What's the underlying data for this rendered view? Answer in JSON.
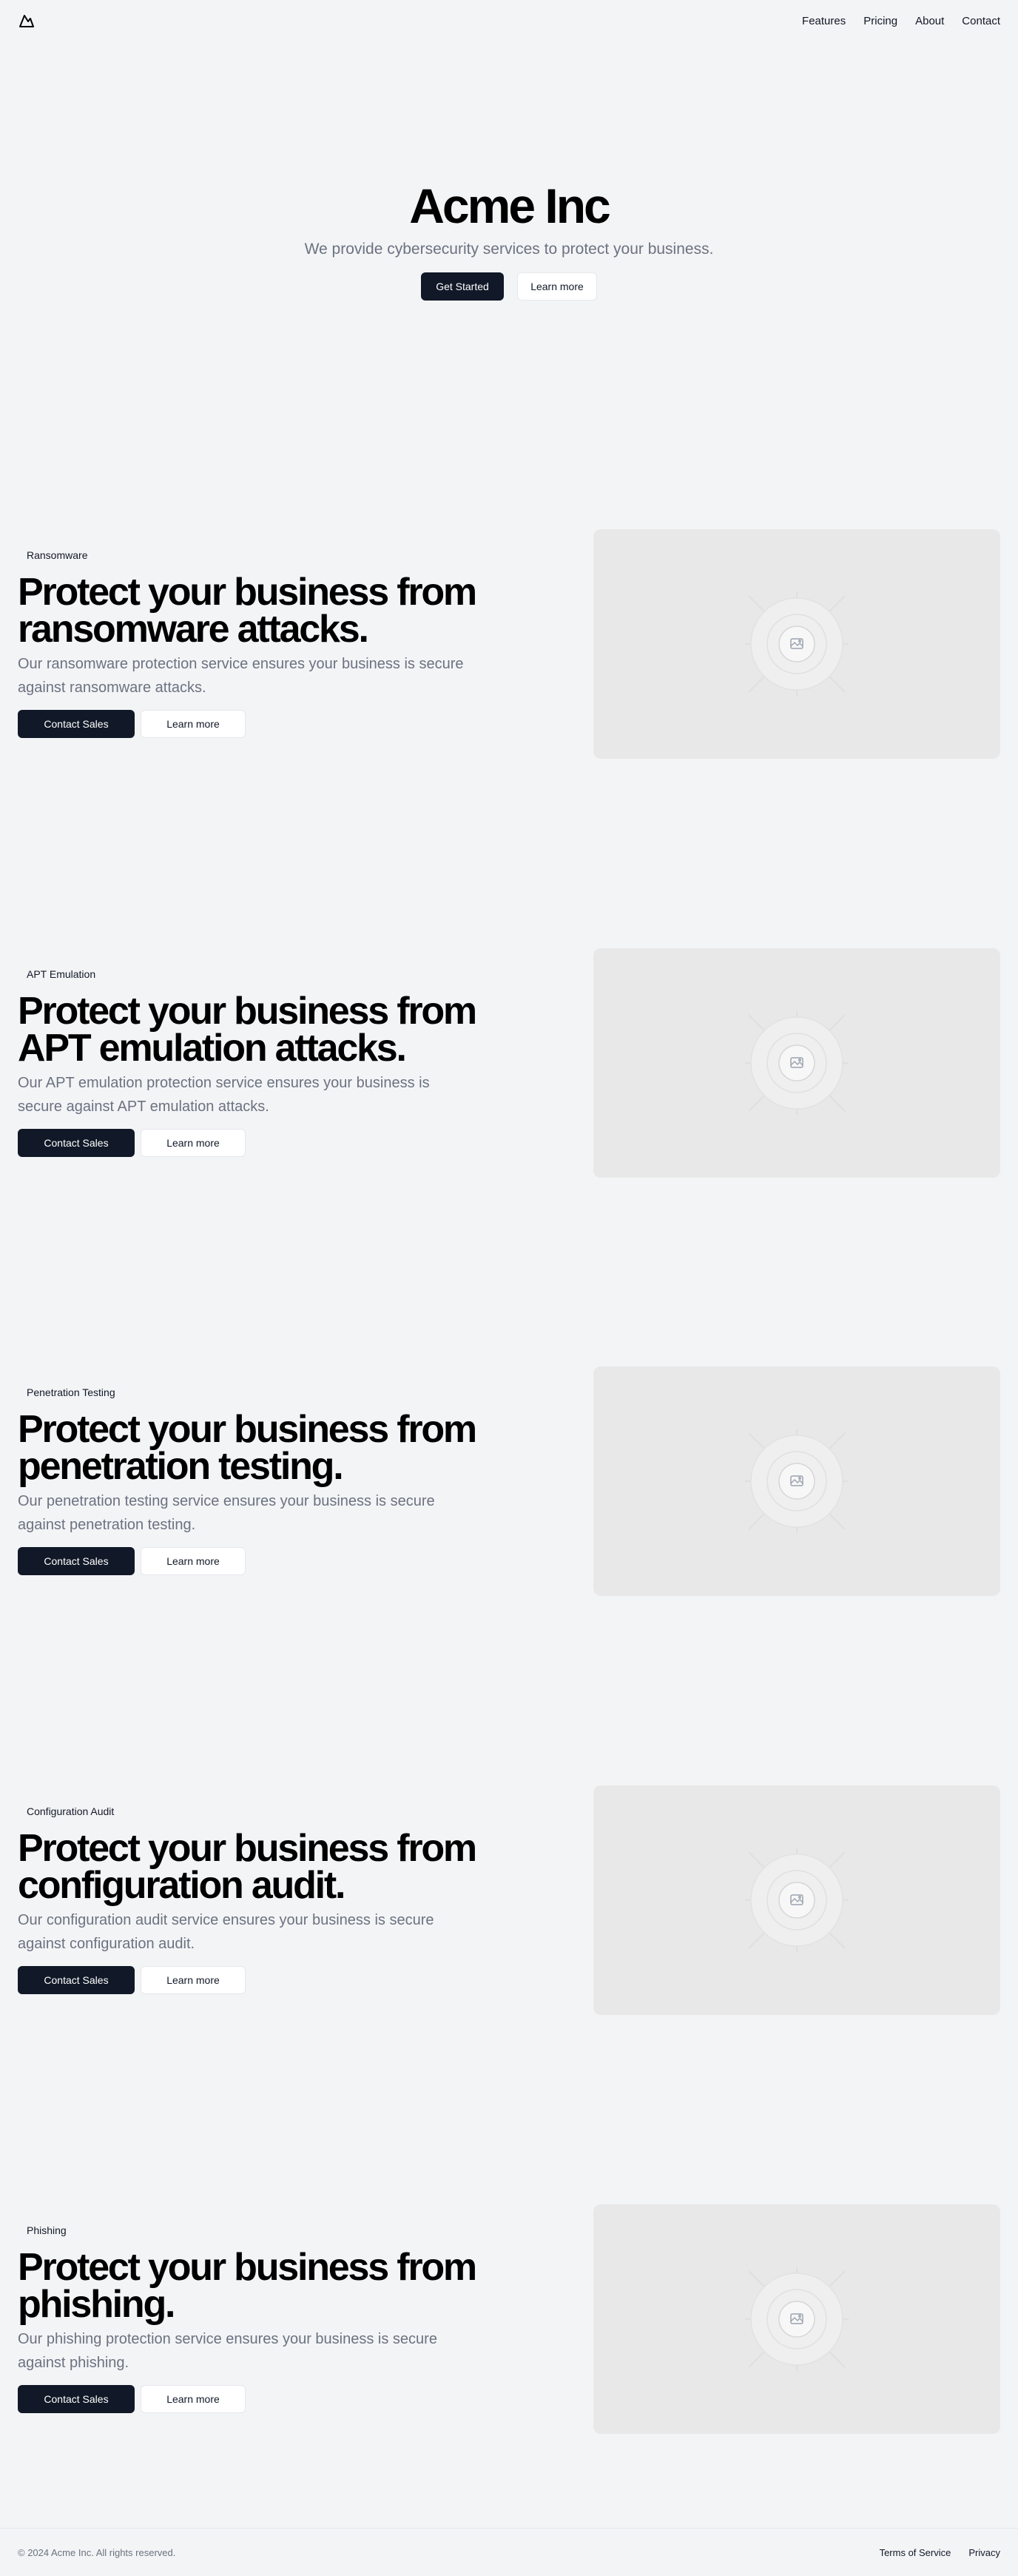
{
  "nav": {
    "items": [
      "Features",
      "Pricing",
      "About",
      "Contact"
    ]
  },
  "hero": {
    "title": "Acme Inc",
    "subtitle": "We provide cybersecurity services to protect your business.",
    "primary_button": "Get Started",
    "secondary_button": "Learn more"
  },
  "features": [
    {
      "badge": "Ransomware",
      "title": "Protect your business from ransomware attacks.",
      "description": "Our ransomware protection service ensures your business is secure against ransomware attacks.",
      "primary_button": "Contact Sales",
      "secondary_button": "Learn more"
    },
    {
      "badge": "APT Emulation",
      "title": "Protect your business from APT emulation attacks.",
      "description": "Our APT emulation protection service ensures your business is secure against APT emulation attacks.",
      "primary_button": "Contact Sales",
      "secondary_button": "Learn more"
    },
    {
      "badge": "Penetration Testing",
      "title": "Protect your business from penetration testing.",
      "description": "Our penetration testing service ensures your business is secure against penetration testing.",
      "primary_button": "Contact Sales",
      "secondary_button": "Learn more"
    },
    {
      "badge": "Configuration Audit",
      "title": "Protect your business from configuration audit.",
      "description": "Our configuration audit service ensures your business is secure against configuration audit.",
      "primary_button": "Contact Sales",
      "secondary_button": "Learn more"
    },
    {
      "badge": "Phishing",
      "title": "Protect your business from phishing.",
      "description": "Our phishing protection service ensures your business is secure against phishing.",
      "primary_button": "Contact Sales",
      "secondary_button": "Learn more"
    }
  ],
  "footer": {
    "copyright": "© 2024 Acme Inc. All rights reserved.",
    "links": [
      "Terms of Service",
      "Privacy"
    ]
  },
  "colors": {
    "background": "#f3f4f6",
    "primary_button": "#111827",
    "muted_text": "#6b7280",
    "placeholder": "#e8e8e8"
  },
  "icons": {
    "logo": "mountain-icon",
    "placeholder": "image-icon"
  }
}
